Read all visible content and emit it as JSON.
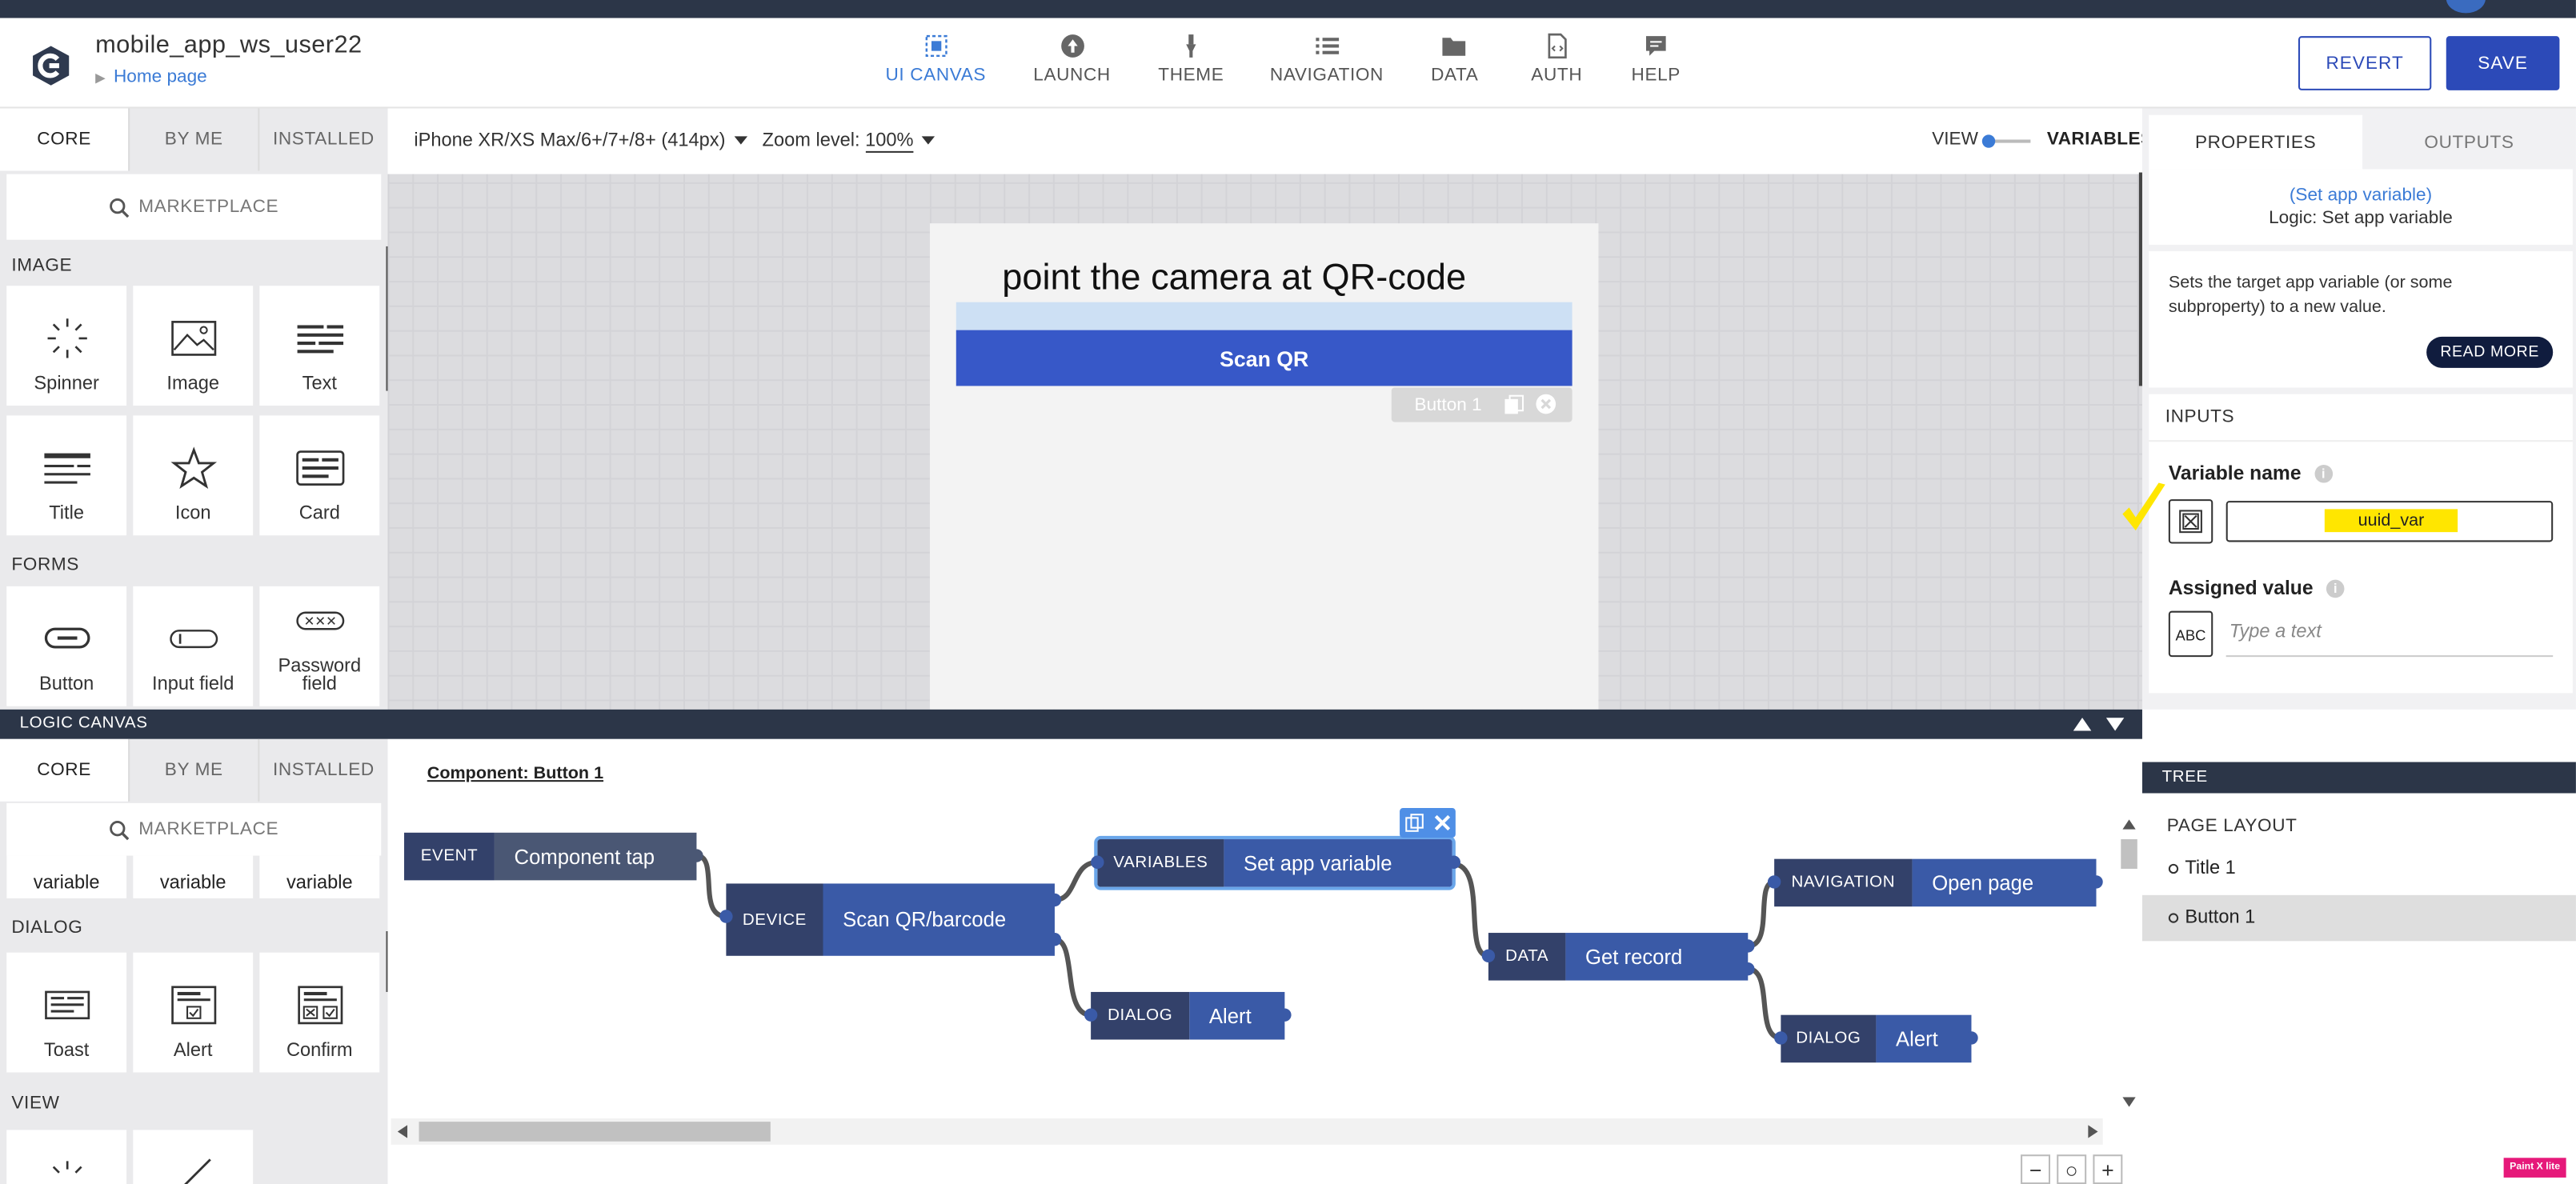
{
  "app": {
    "title": "mobile_app_ws_user22",
    "breadcrumb": "Home page"
  },
  "nav": [
    {
      "label": "UI CANVAS",
      "icon": "ui-canvas-icon",
      "active": true
    },
    {
      "label": "LAUNCH",
      "icon": "launch-icon"
    },
    {
      "label": "THEME",
      "icon": "theme-icon"
    },
    {
      "label": "NAVIGATION",
      "icon": "navigation-icon"
    },
    {
      "label": "DATA",
      "icon": "data-icon"
    },
    {
      "label": "AUTH",
      "icon": "auth-icon"
    },
    {
      "label": "HELP",
      "icon": "help-icon"
    }
  ],
  "actions": {
    "revert": "REVERT",
    "save": "SAVE"
  },
  "leftTabs": [
    "CORE",
    "BY ME",
    "INSTALLED"
  ],
  "marketplace": "MARKETPLACE",
  "sections": {
    "image": "IMAGE",
    "forms": "FORMS",
    "dialog": "DIALOG",
    "view": "VIEW"
  },
  "tiles": {
    "spinner": "Spinner",
    "image": "Image",
    "text": "Text",
    "title": "Title",
    "icon": "Icon",
    "card": "Card",
    "button": "Button",
    "input": "Input field",
    "password": "Password field"
  },
  "logicTiles": {
    "partial1": "variable",
    "partial2": "variable",
    "partial3": "variable",
    "toast": "Toast",
    "alert": "Alert",
    "confirm": "Confirm"
  },
  "canvas": {
    "device": "iPhone XR/XS Max/6+/7+/8+ (414px)",
    "zoomLabel": "Zoom level:",
    "zoomValue": "100%",
    "view": "VIEW",
    "variables": "VARIABLES",
    "phoneTitle": "point the camera at QR-code",
    "scanButton": "Scan QR",
    "componentTag": "Button 1"
  },
  "properties": {
    "tabs": [
      "PROPERTIES",
      "OUTPUTS"
    ],
    "node": "(Set app variable)",
    "logic": "Logic: Set app variable",
    "description": "Sets the target app variable (or some subproperty) to a new value.",
    "readMore": "READ MORE",
    "inputsLabel": "INPUTS",
    "variableName": "Variable name",
    "variableValue": "uuid_var",
    "assignedValue": "Assigned value",
    "textPlaceholder": "Type a text",
    "abcIcon": "ABC"
  },
  "logic": {
    "bar": "LOGIC CANVAS",
    "component": "Component: Button 1",
    "nodes": [
      {
        "kind": "EVENT",
        "label": "Component tap"
      },
      {
        "kind": "DEVICE",
        "label": "Scan QR/barcode"
      },
      {
        "kind": "VARIABLES",
        "label": "Set app variable"
      },
      {
        "kind": "DIALOG",
        "label": "Alert"
      },
      {
        "kind": "DATA",
        "label": "Get record"
      },
      {
        "kind": "NAVIGATION",
        "label": "Open page"
      },
      {
        "kind": "DIALOG",
        "label": "Alert"
      }
    ]
  },
  "tree": {
    "header": "TREE",
    "section": "PAGE LAYOUT",
    "items": [
      "Title 1",
      "Button 1"
    ]
  },
  "colors": {
    "primary": "#2c4ab8",
    "dark": "#2c3648",
    "nodeKey": "#33416a",
    "nodeVal": "#3a5aa7",
    "highlight": "#ffe600"
  }
}
